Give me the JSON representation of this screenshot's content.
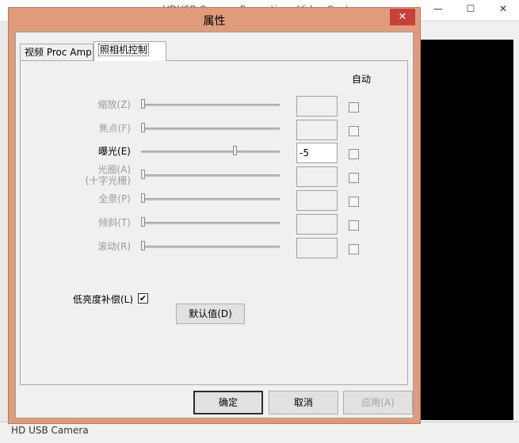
{
  "background_window": {
    "title_partial": "HDUSB Camera Properties - Video Capture",
    "status_text": "HD USB Camera",
    "controls": {
      "minimize": "—",
      "maximize": "☐",
      "close": "✕"
    }
  },
  "dialog": {
    "title": "属性",
    "close_glyph": "✕",
    "tabs": [
      {
        "label": "视频 Proc Amp",
        "active": false
      },
      {
        "label": "照相机控制",
        "active": true
      }
    ],
    "auto_header": "自动",
    "properties": [
      {
        "label": "缩放(Z)",
        "value": "",
        "enabled": false,
        "level": 0.0,
        "auto": false
      },
      {
        "label": "焦点(F)",
        "value": "",
        "enabled": false,
        "level": 0.0,
        "auto": false
      },
      {
        "label": "曝光(E)",
        "value": "-5",
        "enabled": true,
        "level": 0.68,
        "auto": false
      },
      {
        "label": "光圈(A)",
        "label2": "(十字光栅)",
        "value": "",
        "enabled": false,
        "level": 0.0,
        "auto": false
      },
      {
        "label": "全景(P)",
        "value": "",
        "enabled": false,
        "level": 0.0,
        "auto": false
      },
      {
        "label": "倾斜(T)",
        "value": "",
        "enabled": false,
        "level": 0.0,
        "auto": false
      },
      {
        "label": "滚动(R)",
        "value": "",
        "enabled": false,
        "level": 0.0,
        "auto": false
      }
    ],
    "low_light_compensation": {
      "label": "低亮度补偿(L)",
      "checked": true,
      "check_glyph": "✔"
    },
    "reset_button": "默认值(D)",
    "buttons": {
      "ok": "确定",
      "cancel": "取消",
      "apply": "应用(A)"
    }
  }
}
